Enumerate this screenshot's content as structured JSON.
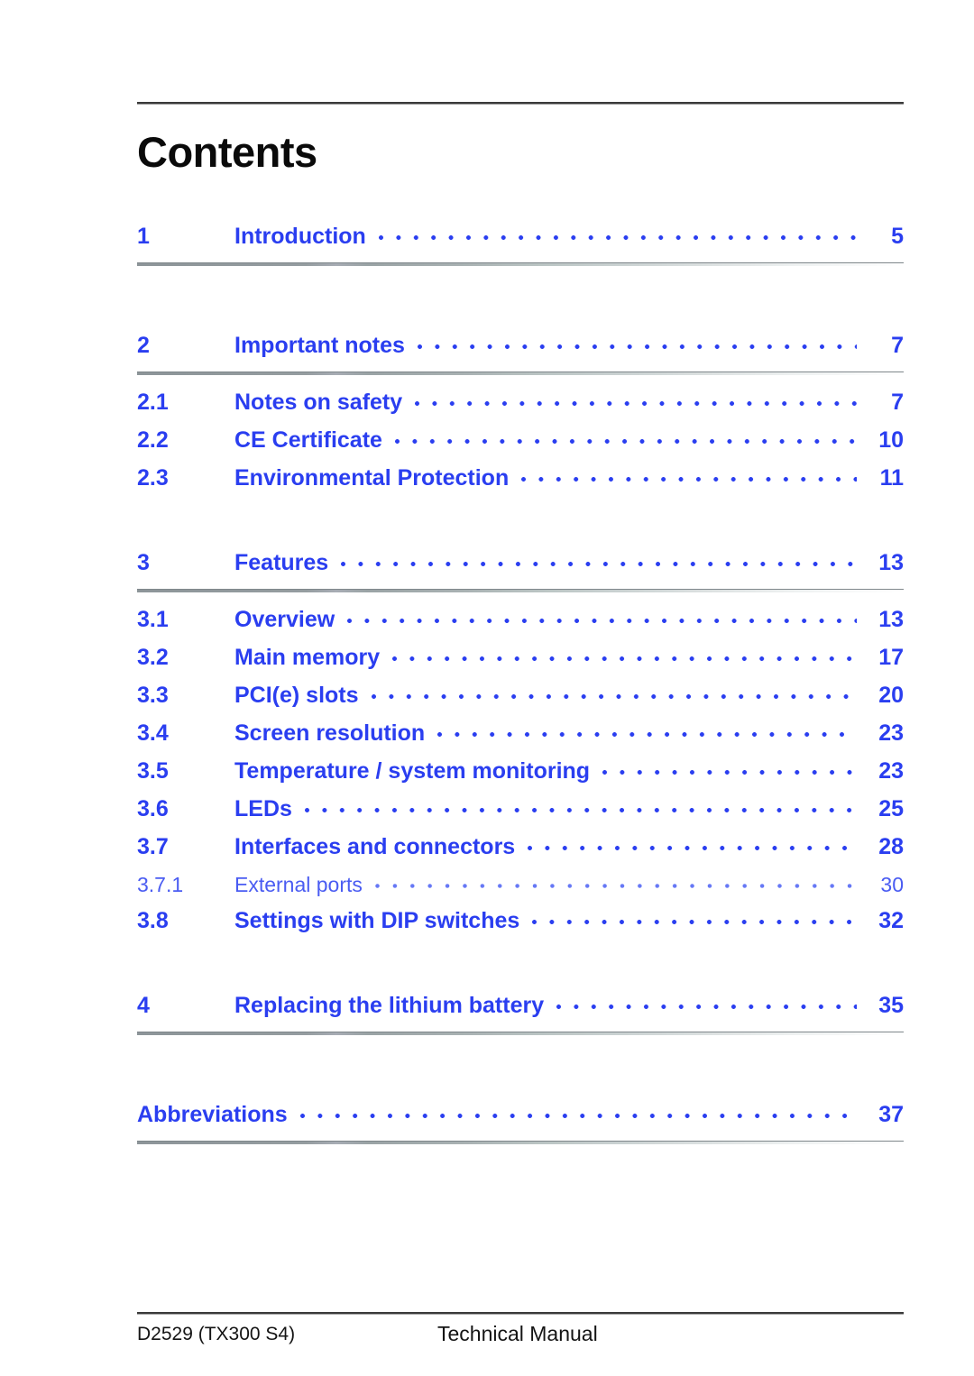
{
  "document": {
    "title": "Contents"
  },
  "colors": {
    "entry_blue": "#2a3ef0",
    "subentry_blue": "#4a5cf2",
    "heading_black": "#0a0a0a",
    "rule_gray": "#3a3a3a"
  },
  "toc": {
    "groups": [
      {
        "heading": {
          "number": "1",
          "label": "Introduction",
          "page": "5",
          "level": 1
        },
        "children": []
      },
      {
        "heading": {
          "number": "2",
          "label": "Important notes",
          "page": "7",
          "level": 1
        },
        "children": [
          {
            "number": "2.1",
            "label": "Notes on safety",
            "page": "7",
            "level": 2
          },
          {
            "number": "2.2",
            "label": "CE Certificate",
            "page": "10",
            "level": 2
          },
          {
            "number": "2.3",
            "label": "Environmental Protection",
            "page": "11",
            "level": 2
          }
        ]
      },
      {
        "heading": {
          "number": "3",
          "label": "Features",
          "page": "13",
          "level": 1
        },
        "children": [
          {
            "number": "3.1",
            "label": "Overview",
            "page": "13",
            "level": 2
          },
          {
            "number": "3.2",
            "label": "Main memory",
            "page": "17",
            "level": 2
          },
          {
            "number": "3.3",
            "label": "PCI(e) slots",
            "page": "20",
            "level": 2
          },
          {
            "number": "3.4",
            "label": "Screen resolution",
            "page": "23",
            "level": 2
          },
          {
            "number": "3.5",
            "label": "Temperature / system monitoring",
            "page": "23",
            "level": 2
          },
          {
            "number": "3.6",
            "label": "LEDs",
            "page": "25",
            "level": 2
          },
          {
            "number": "3.7",
            "label": "Interfaces and connectors",
            "page": "28",
            "level": 2
          },
          {
            "number": "3.7.1",
            "label": "External ports",
            "page": "30",
            "level": 3
          },
          {
            "number": "3.8",
            "label": "Settings with DIP switches",
            "page": "32",
            "level": 2
          }
        ]
      },
      {
        "heading": {
          "number": "4",
          "label": "Replacing the lithium battery",
          "page": "35",
          "level": 1
        },
        "children": []
      },
      {
        "heading": {
          "number": "",
          "label": "Abbreviations",
          "page": "37",
          "level": 1
        },
        "children": []
      }
    ]
  },
  "footer": {
    "left": "D2529 (TX300 S4)",
    "center": "Technical Manual"
  }
}
